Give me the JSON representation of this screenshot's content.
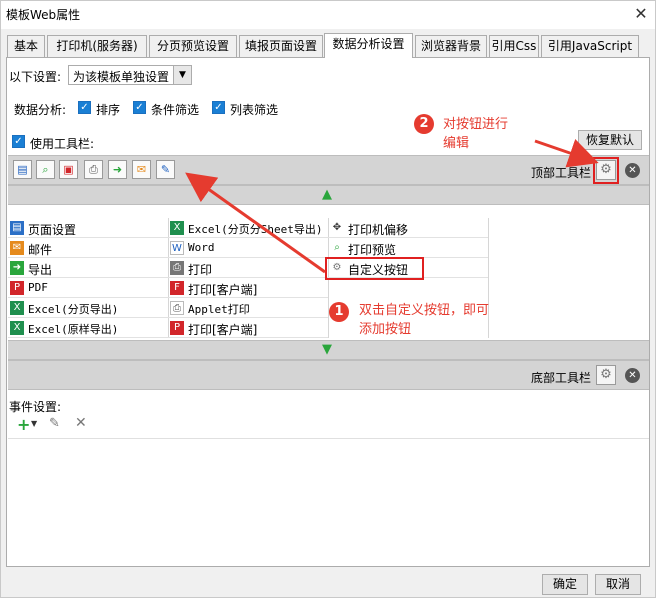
{
  "window": {
    "title": "模板Web属性",
    "close_glyph": "✕"
  },
  "tabs": [
    {
      "label": "基本",
      "active": false
    },
    {
      "label": "打印机(服务器)",
      "active": false
    },
    {
      "label": "分页预览设置",
      "active": false
    },
    {
      "label": "填报页面设置",
      "active": false
    },
    {
      "label": "数据分析设置",
      "active": true
    },
    {
      "label": "浏览器背景",
      "active": false
    },
    {
      "label": "引用Css",
      "active": false
    },
    {
      "label": "引用JavaScript",
      "active": false
    }
  ],
  "settings": {
    "scope_label": "以下设置:",
    "scope_value": "为该模板单独设置",
    "analysis_label": "数据分析:",
    "sort_label": "排序",
    "filter_label": "条件筛选",
    "list_filter_label": "列表筛选",
    "use_toolbar_label": "使用工具栏:",
    "restore_default": "恢复默认"
  },
  "toolbar": {
    "top_label": "顶部工具栏",
    "bottom_label": "底部工具栏"
  },
  "grid": {
    "col1": [
      {
        "icon": "page-setup-icon",
        "label": "页面设置",
        "mono": false
      },
      {
        "icon": "mail-icon",
        "label": "邮件",
        "mono": false
      },
      {
        "icon": "export-icon",
        "label": "导出",
        "mono": false
      },
      {
        "icon": "pdf-icon",
        "label": "PDF",
        "mono": true
      },
      {
        "icon": "excel-icon",
        "label": "Excel(分页导出)",
        "mono": true
      },
      {
        "icon": "excel-icon",
        "label": "Excel(原样导出)",
        "mono": true
      }
    ],
    "col2": [
      {
        "icon": "excel-icon",
        "label": "Excel(分页分Sheet导出)",
        "mono": true
      },
      {
        "icon": "word-icon",
        "label": "Word",
        "mono": true
      },
      {
        "icon": "print-icon",
        "label": "打印",
        "mono": false
      },
      {
        "icon": "flash-print-icon",
        "label": "打印[客户端]",
        "mono": false
      },
      {
        "icon": "applet-print-icon",
        "label": "Applet打印",
        "mono": true
      },
      {
        "icon": "pdf-print-icon",
        "label": "打印[客户端]",
        "mono": false
      }
    ],
    "col3": [
      {
        "icon": "move-icon",
        "label": "打印机偏移",
        "mono": false
      },
      {
        "icon": "preview-icon",
        "label": "打印预览",
        "mono": false
      },
      {
        "icon": "gear-icon",
        "label": "自定义按钮",
        "mono": false
      }
    ]
  },
  "annotations": {
    "step1_number": "1",
    "step1_line1": "双击自定义按钮，即可",
    "step1_line2": "添加按钮",
    "step2_number": "2",
    "step2_line1": "对按钮进行",
    "step2_line2": "编辑",
    "color": "#e53b2f"
  },
  "events": {
    "label": "事件设置:"
  },
  "footer": {
    "ok": "确定",
    "cancel": "取消"
  }
}
